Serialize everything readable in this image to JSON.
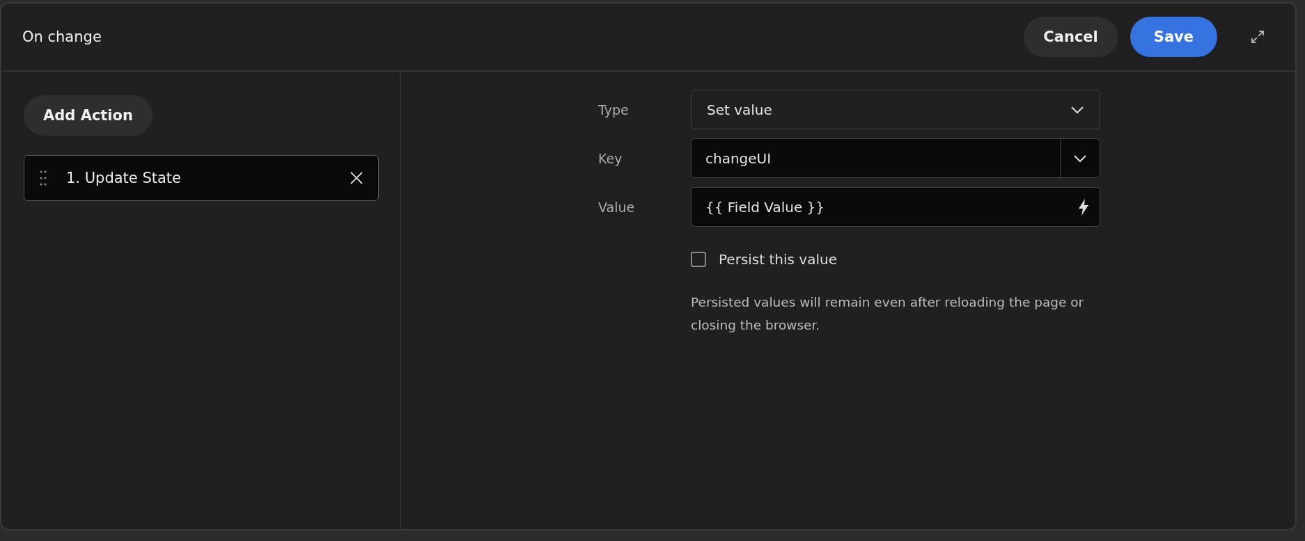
{
  "dialog": {
    "title": "On change"
  },
  "header_buttons": [
    {
      "label": "Cancel",
      "kind": "secondary"
    },
    {
      "label": "Save",
      "kind": "primary"
    }
  ],
  "add_action": {
    "label": "Add Action"
  },
  "actions": [
    {
      "label": "1. Update State",
      "selected": false
    }
  ],
  "form": {
    "fields": [
      {
        "label": "Type",
        "kind": "select",
        "value": "Set value"
      },
      {
        "label": "Key",
        "kind": "combo",
        "value": "changeUI"
      },
      {
        "label": "Value",
        "kind": "dynamic",
        "value": "{{ Field Value }}"
      }
    ],
    "persist": {
      "label": "Persist this value",
      "checked": false
    },
    "help": "Persisted values will remain even after reloading the page or closing the browser."
  }
}
